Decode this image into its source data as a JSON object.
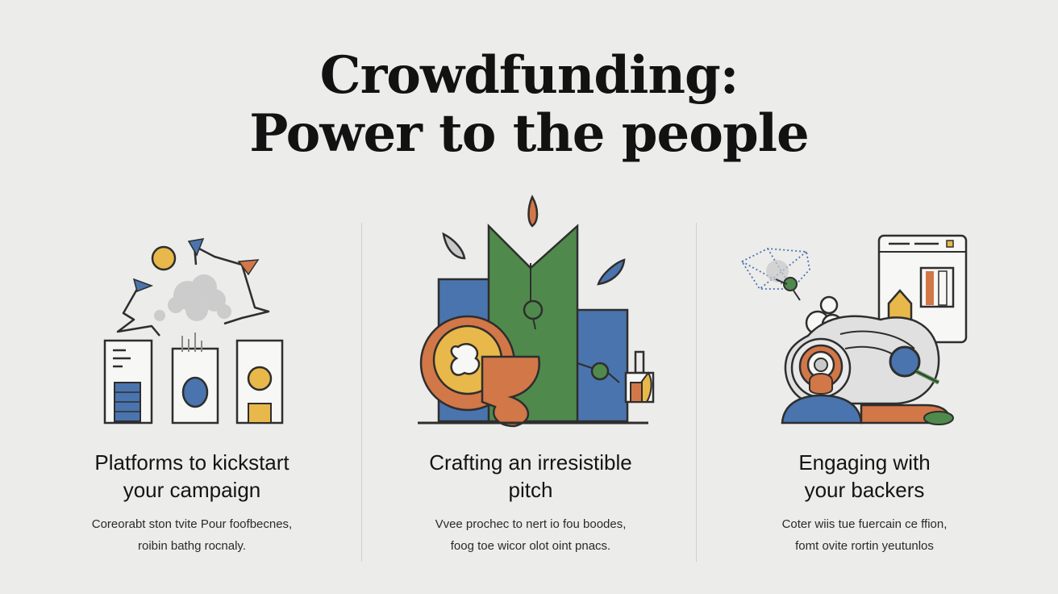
{
  "title": {
    "line1": "Crowdfunding:",
    "line2": "Power to the people"
  },
  "columns": [
    {
      "heading_line1": "Platforms to kickstart",
      "heading_line2": "your campaign",
      "text_line1": "Coreorabt ston tvite Pour foofbecnes,",
      "text_line2": "roibin bathg rocnaly."
    },
    {
      "heading_line1": "Crafting an irresistible",
      "heading_line2": "pitch",
      "text_line1": "Vvee prochec to nert io fou boodes,",
      "text_line2": "foog toe wicor olot oint pnacs."
    },
    {
      "heading_line1": "Engaging with",
      "heading_line2": "your backers",
      "text_line1": "Coter wiis tue fuercain ce ffion,",
      "text_line2": "fomt ovite rortin yeutunlos"
    }
  ],
  "colors": {
    "background": "#ececeb",
    "yellow": "#e8b84a",
    "blue": "#4a74ad",
    "green": "#4f8a4c",
    "orange": "#d27748",
    "outline": "#3a3a3a"
  },
  "icons": [
    "platforms-illustration",
    "pitch-illustration",
    "backers-illustration"
  ]
}
